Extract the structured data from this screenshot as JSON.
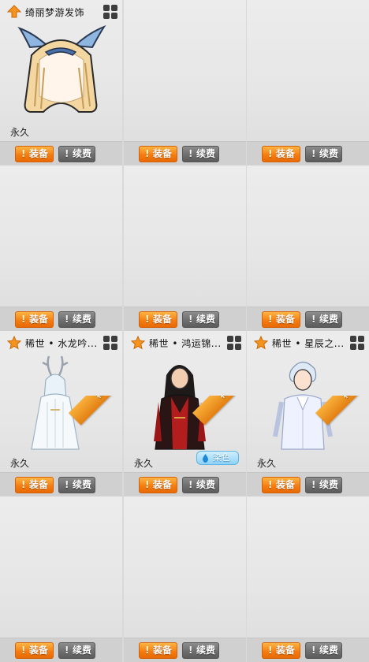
{
  "labels": {
    "equip": "装备",
    "renew": "续费",
    "permanent": "永久",
    "dye": "染色",
    "rare_tag": "稀世"
  },
  "items": [
    {
      "title": "绮丽梦游发饰",
      "icon": "arrow-up-icon",
      "portrait": "hair-accessory-blonde-bow",
      "duration": "永久",
      "rare": false,
      "dye": false
    },
    {
      "title": "",
      "duration": ""
    },
    {
      "title": "",
      "duration": ""
    },
    {
      "title": "",
      "duration": ""
    },
    {
      "title": "",
      "duration": ""
    },
    {
      "title": "",
      "duration": ""
    },
    {
      "title": "稀世 • 水龙吟...",
      "icon": "star-icon",
      "portrait": "white-deer-antler-outfit",
      "duration": "永久",
      "rare": true,
      "dye": false
    },
    {
      "title": "稀世 • 鸿运锦...",
      "icon": "star-icon",
      "portrait": "red-black-robe-outfit",
      "duration": "永久",
      "rare": true,
      "dye": true
    },
    {
      "title": "稀世 • 星辰之...",
      "icon": "star-icon",
      "portrait": "white-suit-outfit",
      "duration": "永久",
      "rare": true,
      "dye": false
    },
    {
      "title": "",
      "duration": ""
    },
    {
      "title": "",
      "duration": ""
    },
    {
      "title": "",
      "duration": ""
    }
  ],
  "colors": {
    "equip_orange": "#f47a10",
    "renew_gray": "#6c6c6c",
    "rare_ribbon": "#f3a22a",
    "dye_blue": "#8fd2f8"
  }
}
